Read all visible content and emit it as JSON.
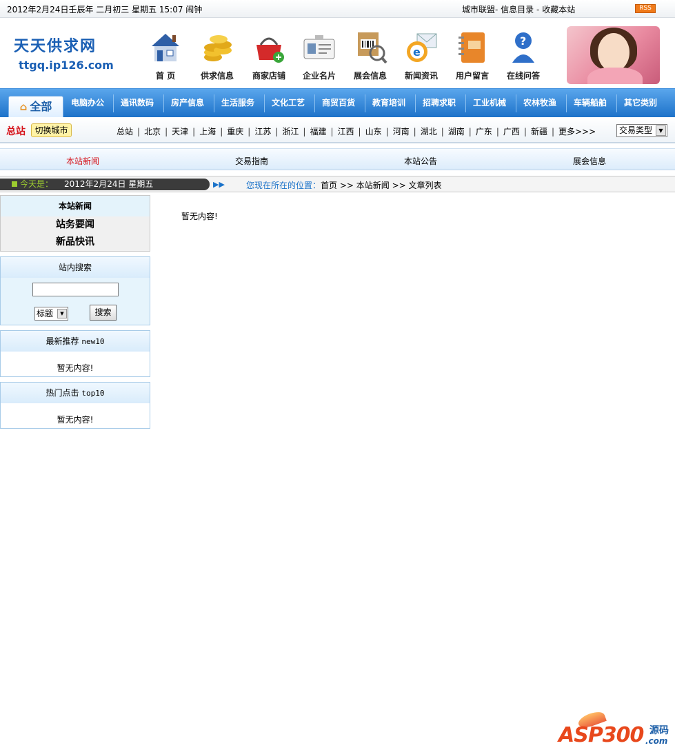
{
  "topbar": {
    "date": "2012年2月24日壬辰年 二月初三 星期五 15:07 闹钟",
    "links": [
      "城市联盟-",
      "信息目录",
      "-",
      "收藏本站"
    ],
    "rss": "RSS"
  },
  "logo": {
    "title": "天天供求网",
    "url": "ttgq.ip126.com"
  },
  "main_nav": [
    {
      "label": "首 页",
      "icon": "house-icon"
    },
    {
      "label": "供求信息",
      "icon": "coins-icon"
    },
    {
      "label": "商家店铺",
      "icon": "basket-icon"
    },
    {
      "label": "企业名片",
      "icon": "id-card-icon"
    },
    {
      "label": "展会信息",
      "icon": "barcode-box-icon"
    },
    {
      "label": "新闻资讯",
      "icon": "ie-mail-icon"
    },
    {
      "label": "用户留言",
      "icon": "notebook-icon"
    },
    {
      "label": "在线问答",
      "icon": "help-person-icon"
    }
  ],
  "categories": {
    "all": "全部",
    "items": [
      "电脑办公",
      "通讯数码",
      "房产信息",
      "生活服务",
      "文化工艺",
      "商贸百货",
      "教育培训",
      "招聘求职",
      "工业机械",
      "农林牧渔",
      "车辆船舶",
      "其它类别"
    ]
  },
  "citybar": {
    "zongzhan": "总站",
    "switch_city": "切换城市",
    "cities": [
      "总站",
      "北京",
      "天津",
      "上海",
      "重庆",
      "江苏",
      "浙江",
      "福建",
      "江西",
      "山东",
      "河南",
      "湖北",
      "湖南",
      "广东",
      "广西",
      "新疆",
      "更多>>>"
    ],
    "type_select": "交易类型"
  },
  "subnav": {
    "items": [
      "本站新闻",
      "交易指南",
      "本站公告",
      "展会信息"
    ],
    "active": "本站新闻"
  },
  "crumbbar": {
    "today_label": "今天是：",
    "today_value": "2012年2月24日  星期五",
    "location_lead": "您现在所在的位置：",
    "path": "首页 >> 本站新闻 >> 文章列表"
  },
  "sidebar": {
    "news": {
      "title": "本站新闻",
      "items": [
        "站务要闻",
        "新品快讯"
      ]
    },
    "search": {
      "title": "站内搜索",
      "input_value": "",
      "select_value": "标题",
      "button": "搜索"
    },
    "recommend": {
      "title_cn": "最新推荐",
      "title_en": "new10",
      "empty": "暂无内容!"
    },
    "hot": {
      "title_cn": "热门点击",
      "title_en": "top10",
      "empty": "暂无内容!"
    }
  },
  "main": {
    "empty": "暂无内容!"
  },
  "watermark": {
    "brand": "ASP300",
    "suffix_cn": "源码",
    "suffix_en": ".com"
  },
  "colors": {
    "brand_blue": "#1a5fb4",
    "category_bar": "#1d72c9",
    "accent_red": "#d6141b",
    "rss_orange": "#f07b1b"
  }
}
